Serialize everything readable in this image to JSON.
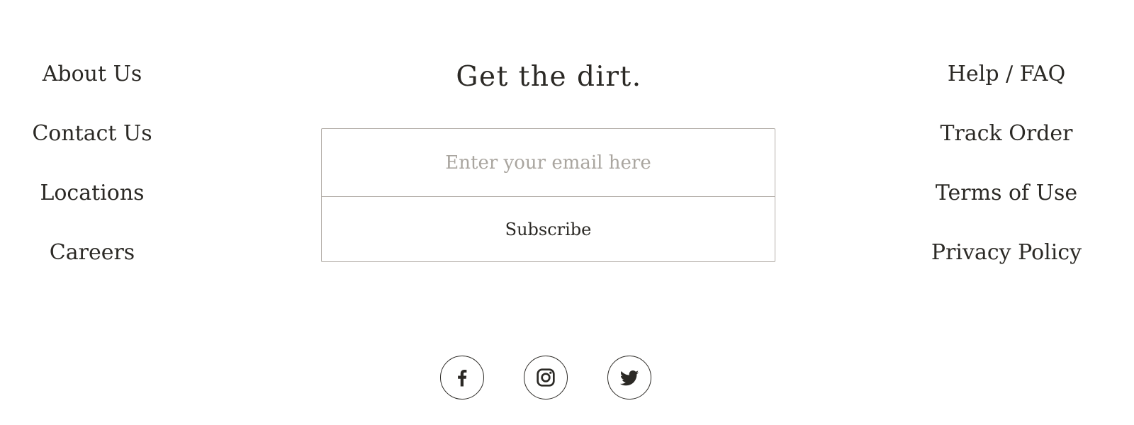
{
  "left_links": [
    {
      "label": "About Us"
    },
    {
      "label": "Contact Us"
    },
    {
      "label": "Locations"
    },
    {
      "label": "Careers"
    }
  ],
  "newsletter": {
    "heading": "Get the dirt.",
    "email_placeholder": "Enter your email here",
    "email_value": "",
    "subscribe_label": "Subscribe"
  },
  "right_links": [
    {
      "label": "Help / FAQ"
    },
    {
      "label": "Track Order"
    },
    {
      "label": "Terms of Use"
    },
    {
      "label": "Privacy Policy"
    }
  ],
  "social": [
    {
      "icon": "facebook-icon"
    },
    {
      "icon": "instagram-icon"
    },
    {
      "icon": "twitter-icon"
    }
  ],
  "colors": {
    "text": "#2b2925",
    "border": "#b3aea8",
    "placeholder": "#a9a59f",
    "background": "#ffffff"
  }
}
